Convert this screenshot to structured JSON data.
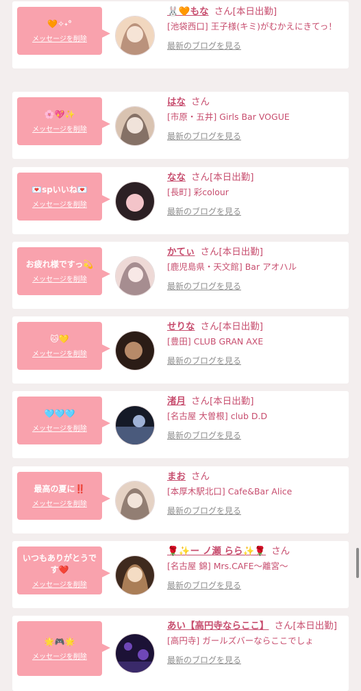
{
  "cards": [
    {
      "message": "🧡✧˖°",
      "delete_label": "メッセージを削除",
      "name": "🐰🧡もな",
      "suffix": "さん[本日出勤]",
      "shop": "[池袋西口] 王子様(キミ)がむかえにきてっ！",
      "blog_label": "最新のブログを見る",
      "avatar_colors": [
        "#f1d7bf",
        "#8d5a45"
      ]
    },
    {
      "message": "🌸💖✨",
      "delete_label": "メッセージを削除",
      "name": "はな",
      "suffix": "さん",
      "shop": "[市原・五井] Girls Bar VOGUE",
      "blog_label": "最新のブログを見る",
      "avatar_colors": [
        "#d9c3b1",
        "#4c3a33"
      ]
    },
    {
      "message": "💌spいいね💌",
      "delete_label": "メッセージを削除",
      "name": "なな",
      "suffix": "さん[本日出勤]",
      "shop": "[長町] 彩colour",
      "blog_label": "最新のブログを見る",
      "avatar_colors": [
        "#f3c4c9",
        "#2c2024"
      ]
    },
    {
      "message": "お疲れ様ですっ💫",
      "delete_label": "メッセージを削除",
      "name": "かてぃ",
      "suffix": "さん[本日出勤]",
      "shop": "[鹿児島県・天文館] Bar アオハル",
      "blog_label": "最新のブログを見る",
      "avatar_colors": [
        "#eed9d6",
        "#6b4f58"
      ]
    },
    {
      "message": "🐱💛",
      "delete_label": "メッセージを削除",
      "name": "せりな",
      "suffix": "さん[本日出勤]",
      "shop": "[豊田] CLUB GRAN AXE",
      "blog_label": "最新のブログを見る",
      "avatar_colors": [
        "#b78a69",
        "#2b1c16"
      ]
    },
    {
      "message": "🩵🩵🩵",
      "delete_label": "メッセージを削除",
      "name": "渚月",
      "suffix": "さん[本日出勤]",
      "shop": "[名古屋 大曽根] club D.D",
      "blog_label": "最新のブログを見る",
      "avatar_colors": [
        "#4a5a7c",
        "#151a27"
      ]
    },
    {
      "message": "最高の夏に‼️",
      "delete_label": "メッセージを削除",
      "name": "まお",
      "suffix": "さん",
      "shop": "[本厚木駅北口] Cafe&Bar Alice",
      "blog_label": "最新のブログを見る",
      "avatar_colors": [
        "#e5d2c4",
        "#5a463d"
      ]
    },
    {
      "message": "いつもありがとうです❤️",
      "delete_label": "メッセージを削除",
      "name": "🌹✨ー ノ瀬 らら✨🌹",
      "suffix": "さん",
      "shop": "[名古屋 錦] Mrs.CAFE〜離宮〜",
      "blog_label": "最新のブログを見る",
      "avatar_colors": [
        "#d9a36f",
        "#3f2a1e"
      ]
    },
    {
      "message": "🌟🎮🌟",
      "delete_label": "メッセージを削除",
      "name": "あい【高円寺ならここ】",
      "suffix": "さん[本日出勤]",
      "shop": "[高円寺] ガールズバーならここでしょ",
      "blog_label": "最新のブログを見る",
      "avatar_colors": [
        "#6f47b8",
        "#1c1236"
      ]
    }
  ]
}
